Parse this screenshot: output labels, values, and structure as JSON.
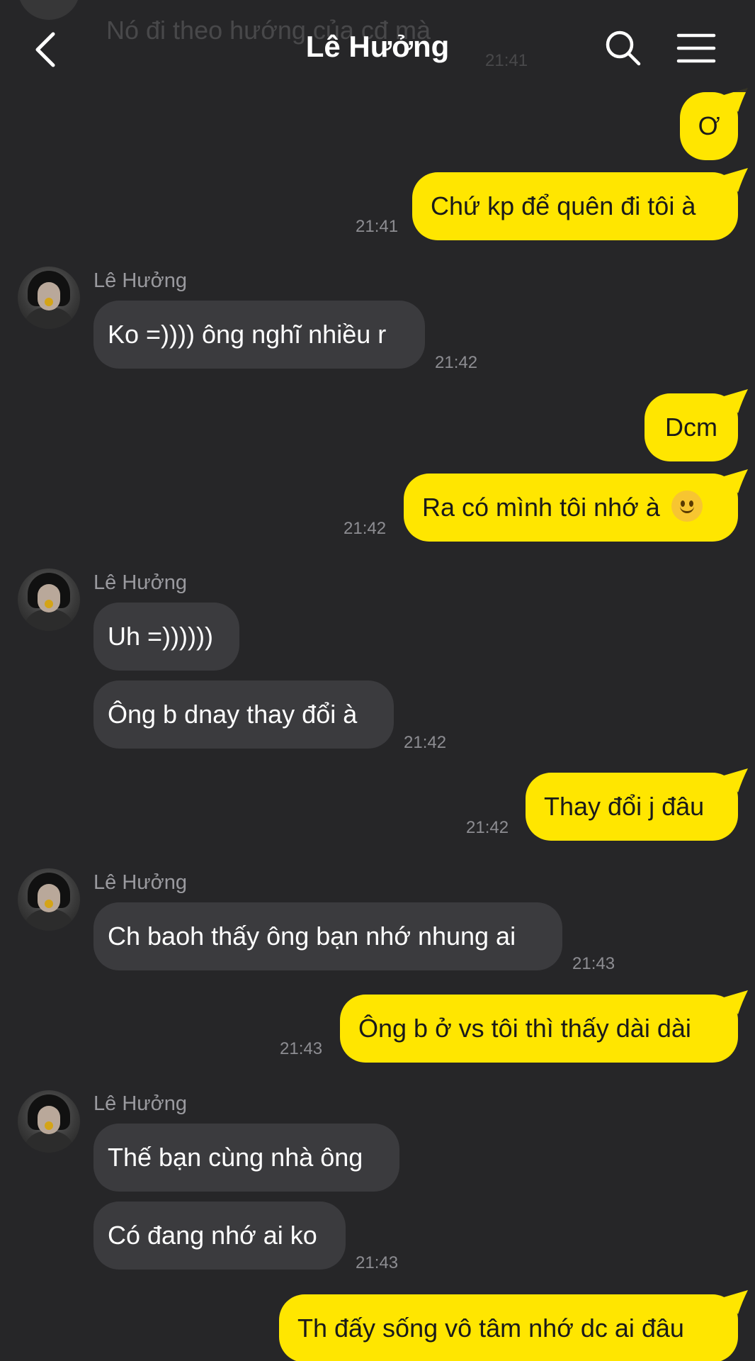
{
  "header": {
    "title": "Lê Hưởng",
    "ghost_text": "Nó đi theo hướng của cđ mà",
    "ghost_time": "21:41"
  },
  "colors": {
    "background": "#262628",
    "outgoing_bubble": "#ffe600",
    "incoming_bubble": "#3b3b3e",
    "timestamp": "#8d8d92"
  },
  "icons": [
    "back-icon",
    "search-icon",
    "menu-icon"
  ],
  "messages": [
    {
      "dir": "out",
      "text": "Ơ"
    },
    {
      "dir": "out",
      "text": "Chứ kp để quên đi tôi à",
      "time": "21:41"
    },
    {
      "dir": "in",
      "sender": "Lê Hưởng",
      "text": "Ko =)))) ông nghĩ nhiều r",
      "time": "21:42"
    },
    {
      "dir": "out",
      "text": "Dcm"
    },
    {
      "dir": "out",
      "text": "Ra có mình tôi nhớ à",
      "emoji": "slightly-smiling-face",
      "time": "21:42"
    },
    {
      "dir": "in",
      "sender": "Lê Hưởng",
      "text": "Uh =))))))"
    },
    {
      "dir": "in",
      "text": "Ông b dnay thay đổi à",
      "time": "21:42"
    },
    {
      "dir": "out",
      "text": "Thay đổi j đâu",
      "time": "21:42"
    },
    {
      "dir": "in",
      "sender": "Lê Hưởng",
      "text": "Ch baoh thấy ông bạn nhớ nhung ai",
      "time": "21:43"
    },
    {
      "dir": "out",
      "text": "Ông b ở vs tôi thì thấy dài dài",
      "time": "21:43"
    },
    {
      "dir": "in",
      "sender": "Lê Hưởng",
      "text": "Thế bạn cùng nhà ông"
    },
    {
      "dir": "in",
      "text": "Có đang nhớ ai ko",
      "time": "21:43"
    },
    {
      "dir": "out",
      "text": "Th đấy sống vô tâm nhớ dc ai đâu"
    }
  ]
}
